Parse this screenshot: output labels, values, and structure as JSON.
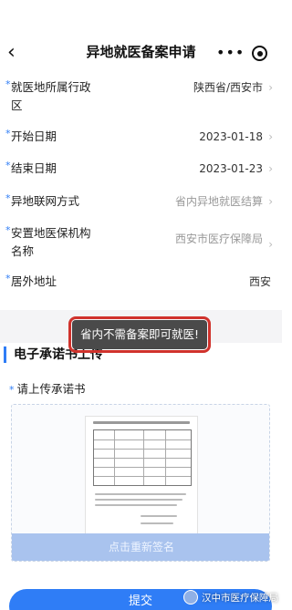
{
  "header": {
    "title": "异地就医备案申请",
    "back_icon": "‹",
    "more_icon": "•••"
  },
  "form": {
    "rows": [
      {
        "label": "就医地所属行政区",
        "value": "陕西省/西安市",
        "required": true,
        "chevron": true,
        "value_muted": false
      },
      {
        "label": "开始日期",
        "value": "2023-01-18",
        "required": true,
        "chevron": true,
        "value_muted": false
      },
      {
        "label": "结束日期",
        "value": "2023-01-23",
        "required": true,
        "chevron": true,
        "value_muted": false
      },
      {
        "label": "异地联网方式",
        "value": "省内异地就医结算",
        "required": true,
        "chevron": true,
        "value_muted": true
      },
      {
        "label": "安置地医保机构名称",
        "value": "西安市医疗保障局",
        "required": true,
        "chevron": true,
        "value_muted": true
      },
      {
        "label": "居外地址",
        "value": "西安",
        "required": true,
        "chevron": false,
        "value_muted": false
      }
    ],
    "required_mark": "*"
  },
  "toast": {
    "text": "省内不需备案即可就医!"
  },
  "commitment": {
    "section_title": "电子承诺书上传",
    "upload_label": "请上传承诺书",
    "resign_label": "点击重新签名"
  },
  "submit": {
    "label": "提交"
  },
  "watermark": {
    "text": "汉中市医疗保障局"
  },
  "colors": {
    "accent": "#2f7df6",
    "toast_bg": "#4a4a4a",
    "highlight": "#d0322c"
  }
}
